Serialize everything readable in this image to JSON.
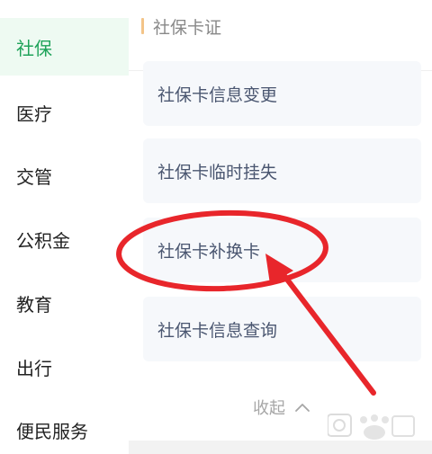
{
  "sidebar": {
    "items": [
      {
        "label": "社保",
        "active": true
      },
      {
        "label": "医疗",
        "active": false
      },
      {
        "label": "交管",
        "active": false
      },
      {
        "label": "公积金",
        "active": false
      },
      {
        "label": "教育",
        "active": false
      },
      {
        "label": "出行",
        "active": false
      },
      {
        "label": "便民服务",
        "active": false
      }
    ]
  },
  "main": {
    "section_title": "社保卡证",
    "services": [
      {
        "label": "社保卡信息变更"
      },
      {
        "label": "社保卡临时挂失"
      },
      {
        "label": "社保卡补换卡"
      },
      {
        "label": "社保卡信息查询"
      }
    ],
    "collapse_label": "收起"
  },
  "icons": {
    "collapse": "chevron-up-icon"
  },
  "colors": {
    "active_green": "#1fa35a",
    "active_bg": "#eefaf2",
    "annotation_red": "#e8262b",
    "section_bar": "#f3c488"
  }
}
